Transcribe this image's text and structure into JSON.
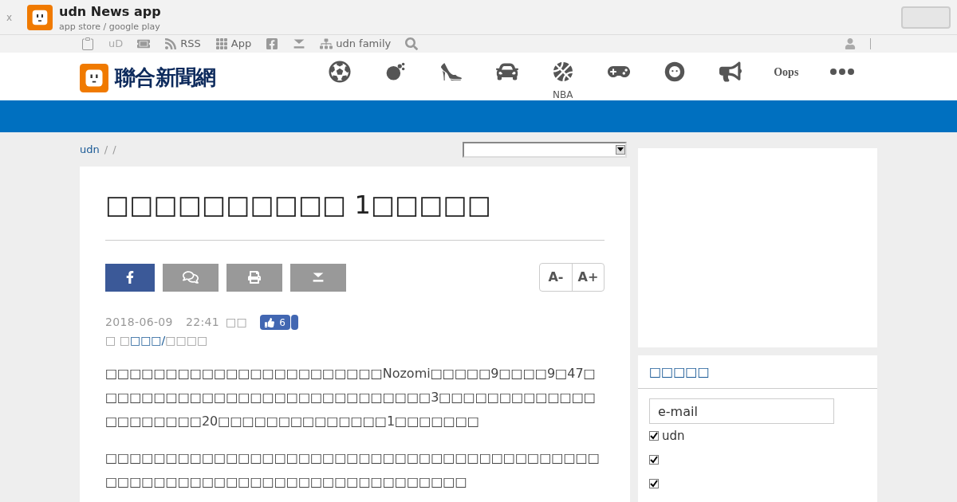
{
  "app_banner": {
    "close": "x",
    "title": "udn News app",
    "subtitle": "app store / google play"
  },
  "toolbar": {
    "items": [
      {
        "kind": "icon"
      },
      {
        "kind": "text",
        "label": "uD"
      },
      {
        "kind": "icon"
      },
      {
        "kind": "icon",
        "label": "RSS"
      },
      {
        "kind": "icon",
        "label": "App"
      },
      {
        "kind": "icon"
      },
      {
        "kind": "icon"
      },
      {
        "kind": "icon",
        "label": "udn family"
      },
      {
        "kind": "icon"
      }
    ]
  },
  "header": {
    "logo": "聯合新聞網",
    "nav": [
      {
        "kind": "icon"
      },
      {
        "kind": "icon"
      },
      {
        "kind": "icon"
      },
      {
        "kind": "icon"
      },
      {
        "kind": "icon",
        "label": "NBA"
      },
      {
        "kind": "icon"
      },
      {
        "kind": "icon"
      },
      {
        "kind": "icon"
      },
      {
        "kind": "text",
        "label": "Oops"
      },
      {
        "kind": "icon"
      }
    ]
  },
  "breadcrumb": [
    "udn",
    "/",
    "/"
  ],
  "article": {
    "headline": "□□□□□□□□□□ 1□□□□□",
    "date": "2018-06-09",
    "time": "22:41",
    "source": "□□",
    "likes": "6",
    "byline": [
      "□ □",
      "□□□/",
      "□□□□"
    ],
    "paragraphs": [
      "□□□□□□□□□□□□□□□□□□□□□□□Nozomi□□□□□9□□□□9□47□□□□□□□□□□□□□□□□□□□□□□□□□□□□3□□□□□□□□□□□□□□□□□□□□□20□□□□□□□□□□□□□□1□□□□□□□",
      "□□□□□□□□□□□□□□□□□□□□□□□□□□□□□□□□□□□□□□□□□□□□□□□□□□□□□□□□□□□□□□□□□□□□□□□"
    ],
    "font_buttons": [
      "A-",
      "A+"
    ]
  },
  "newsletter": {
    "title": "□□□□□",
    "placeholder": "e-mail",
    "options": [
      {
        "label": "udn",
        "checked": true
      },
      {
        "checked": true
      },
      {
        "checked": true
      }
    ]
  }
}
